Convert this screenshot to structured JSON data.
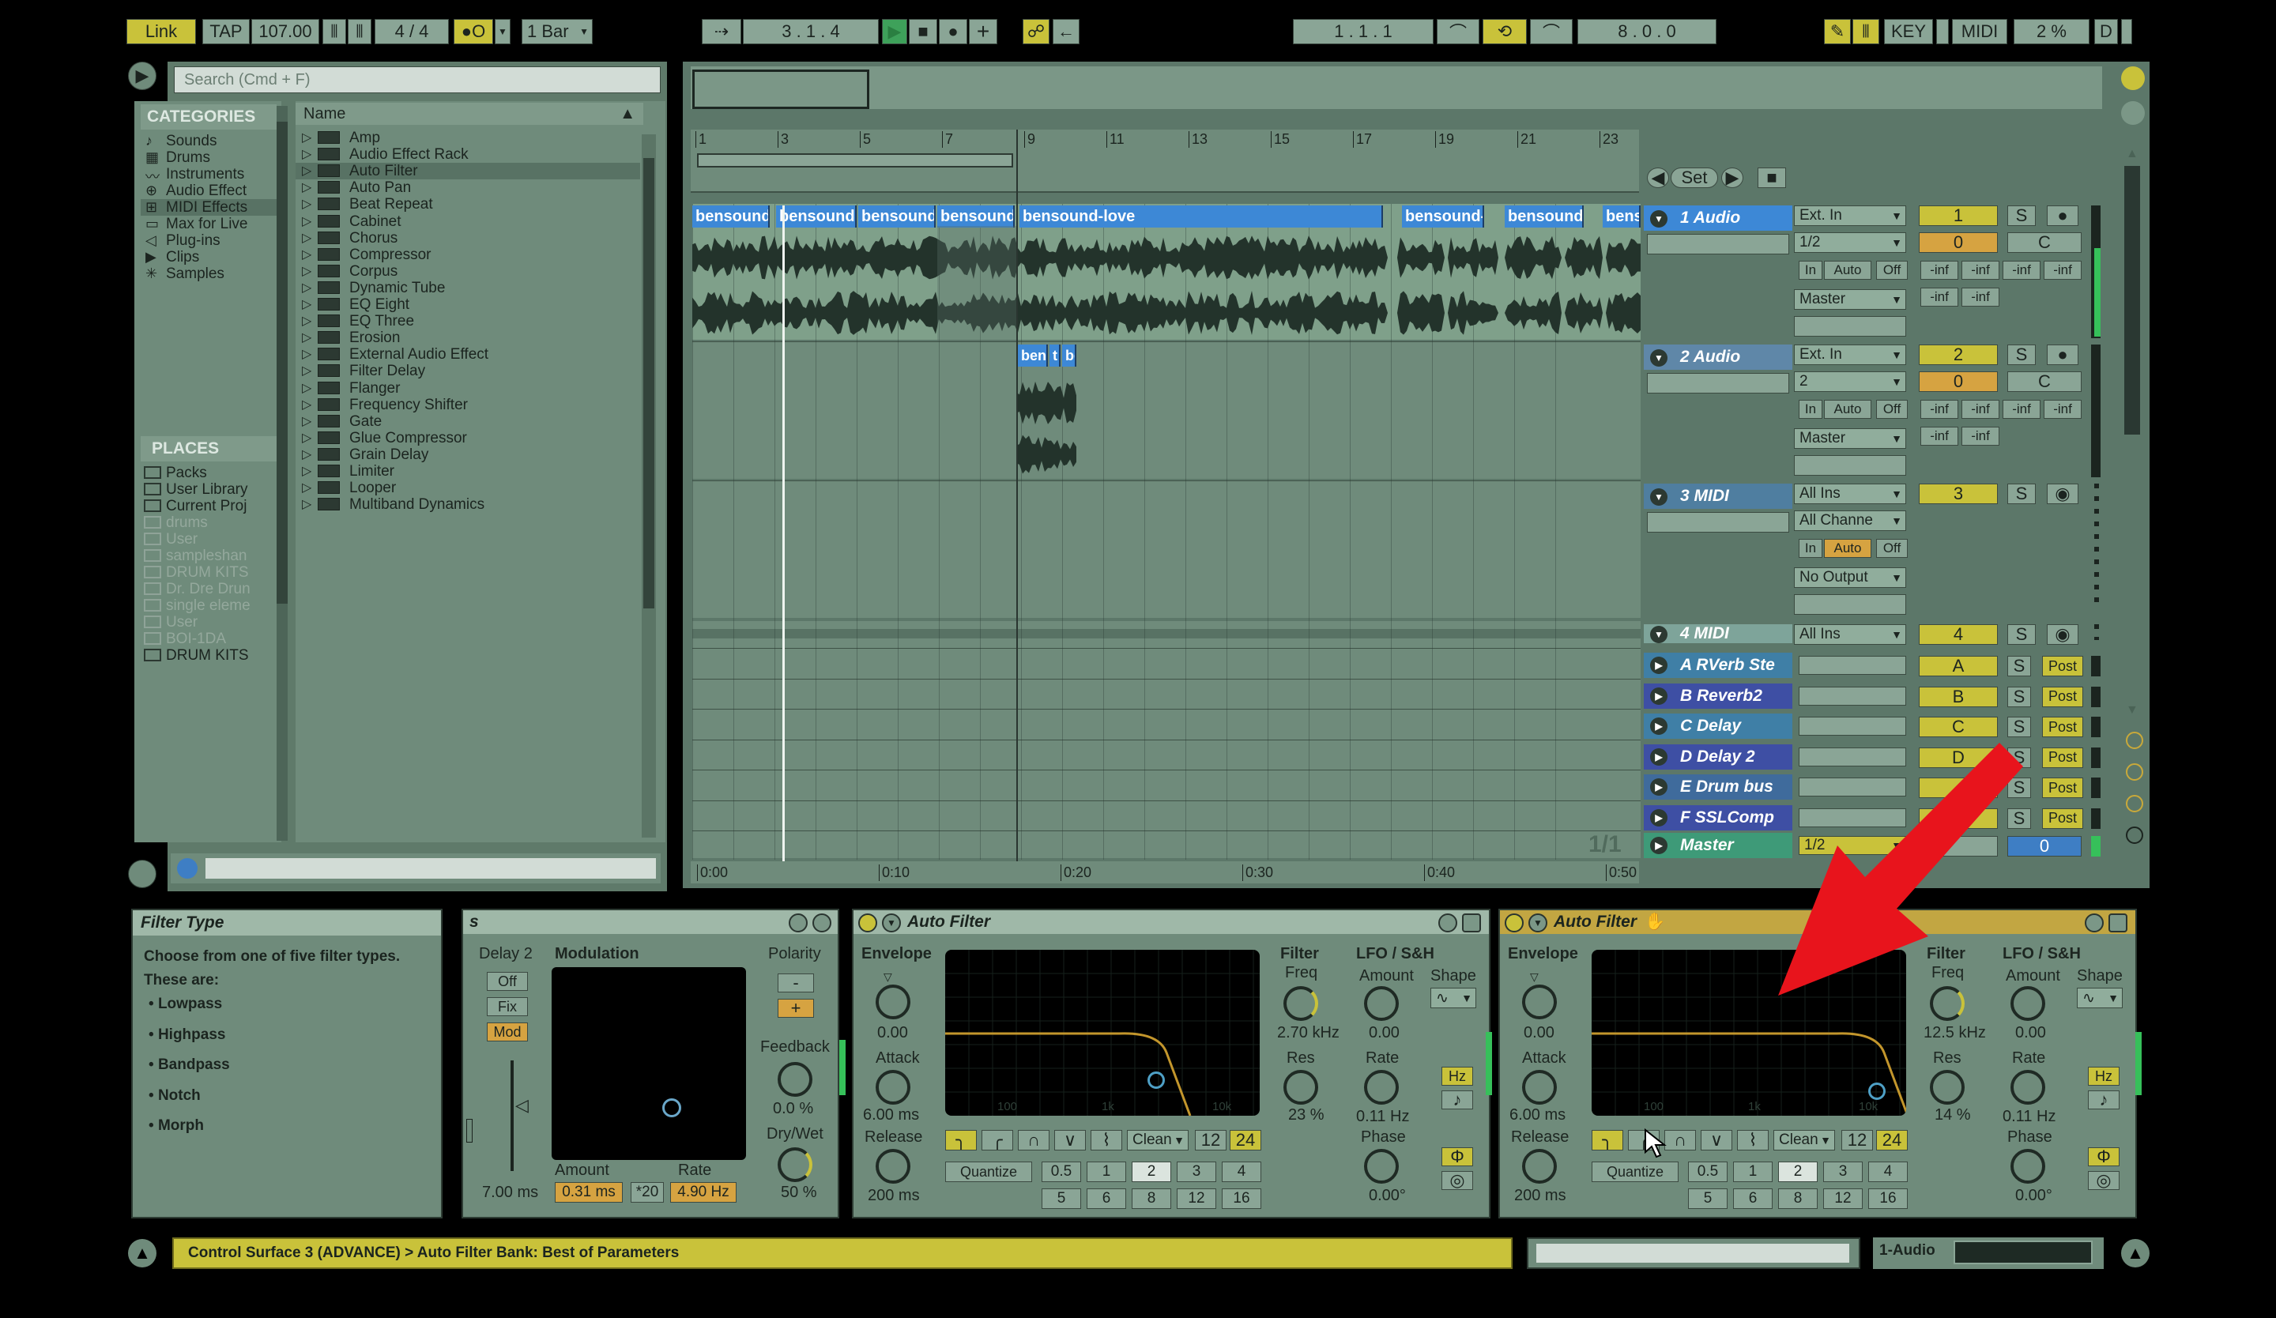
{
  "transport": {
    "link": "Link",
    "tap": "TAP",
    "tempo": "107.00",
    "sig_num": "4",
    "sig_den": "4",
    "quantize": "1 Bar",
    "position": "3 .  1 .  4",
    "loop_start": "1 .  1 .  1",
    "loop_len": "8 .  0 .  0",
    "key": "KEY",
    "midi": "MIDI",
    "cpu": "2 %",
    "d": "D",
    "metronome": "●O"
  },
  "browser": {
    "search_placeholder": "Search (Cmd + F)",
    "categories_title": "CATEGORIES",
    "categories": [
      "Sounds",
      "Drums",
      "Instruments",
      "Audio Effect",
      "MIDI Effects",
      "Max for Live",
      "Plug-ins",
      "Clips",
      "Samples"
    ],
    "places_title": "PLACES",
    "places": [
      "Packs",
      "User Library",
      "Current Proj",
      "drums",
      "User",
      "sampleshan",
      "DRUM KITS",
      "Dr. Dre Drun",
      "single eleme",
      "User",
      "BOI-1DA",
      "DRUM KITS"
    ],
    "name_header": "Name",
    "items": [
      "Amp",
      "Audio Effect Rack",
      "Auto Filter",
      "Auto Pan",
      "Beat Repeat",
      "Cabinet",
      "Chorus",
      "Compressor",
      "Corpus",
      "Dynamic Tube",
      "EQ Eight",
      "EQ Three",
      "Erosion",
      "External Audio Effect",
      "Filter Delay",
      "Flanger",
      "Frequency Shifter",
      "Gate",
      "Glue Compressor",
      "Grain Delay",
      "Limiter",
      "Looper",
      "Multiband Dynamics"
    ]
  },
  "arrangement": {
    "ruler": [
      "1",
      "3",
      "5",
      "7",
      "9",
      "11",
      "13",
      "15",
      "17",
      "19",
      "21",
      "23"
    ],
    "time_ruler": [
      "0:00",
      "0:10",
      "0:20",
      "0:30",
      "0:40",
      "0:50"
    ],
    "set_label": "Set",
    "page": "1/1",
    "clips_track1": [
      "bensound-",
      "bensound-",
      "bensound-",
      "bensound-",
      "bensound-love",
      "bensound-",
      "bensound-",
      "bens"
    ],
    "clips_track2": [
      "ben",
      "t",
      "be"
    ]
  },
  "tracks": [
    {
      "name": "1 Audio",
      "input": "Ext. In",
      "channel": "1/2",
      "out": "Master",
      "num": "1",
      "vol": "0",
      "pan": "C"
    },
    {
      "name": "2 Audio",
      "input": "Ext. In",
      "channel": "2",
      "out": "Master",
      "num": "2",
      "vol": "0",
      "pan": "C"
    },
    {
      "name": "3 MIDI",
      "input": "All Ins",
      "channel": "All Channe",
      "out": "No Output",
      "num": "3"
    },
    {
      "name": "4 MIDI",
      "input": "All Ins",
      "num": "4"
    }
  ],
  "returns": [
    {
      "name": "A RVerb Ste",
      "letter": "A"
    },
    {
      "name": "B Reverb2",
      "letter": "B"
    },
    {
      "name": "C Delay",
      "letter": "C"
    },
    {
      "name": "D Delay 2",
      "letter": "D"
    },
    {
      "name": "E Drum bus",
      "letter": ""
    },
    {
      "name": "F SSLComp",
      "letter": ""
    }
  ],
  "master": {
    "name": "Master",
    "channel": "1/2",
    "vol": "0"
  },
  "mixer_labels": {
    "in": "In",
    "auto": "Auto",
    "off": "Off",
    "inf": "-inf",
    "s": "S",
    "post": "Post"
  },
  "info": {
    "title": "Filter Type",
    "body": "Choose from one of five filter types. These are:",
    "bullets": [
      "Lowpass",
      "Highpass",
      "Bandpass",
      "Notch",
      "Morph"
    ]
  },
  "delay_device": {
    "title": "s",
    "delay_label": "Delay 2",
    "off": "Off",
    "fix": "Fix",
    "mod": "Mod",
    "time": "7.00 ms",
    "modulation": "Modulation",
    "amount": "Amount",
    "rate": "Rate",
    "amount_val": "0.31 ms",
    "rate_mult": "*20",
    "rate_val": "4.90 Hz",
    "polarity": "Polarity",
    "minus": "-",
    "plus": "+",
    "feedback": "Feedback",
    "feedback_val": "0.0 %",
    "drywet": "Dry/Wet",
    "drywet_val": "50 %"
  },
  "filter1": {
    "title": "Auto Filter",
    "envelope": "Envelope",
    "env_amt": "0.00",
    "attack": "Attack",
    "attack_val": "6.00 ms",
    "release": "Release",
    "release_val": "200 ms",
    "filter": "Filter",
    "freq": "Freq",
    "freq_val": "2.70 kHz",
    "res": "Res",
    "res_val": "23 %",
    "lfo": "LFO / S&H",
    "lfo_amt": "Amount",
    "lfo_amt_val": "0.00",
    "shape": "Shape",
    "rate": "Rate",
    "rate_val": "0.11 Hz",
    "phase": "Phase",
    "phase_val": "0.00°",
    "clean": "Clean",
    "p12": "12",
    "p24": "24",
    "quantize": "Quantize",
    "hz": "Hz",
    "grid": [
      "0.5",
      "1",
      "2",
      "3",
      "4",
      "5",
      "6",
      "8",
      "12",
      "16"
    ],
    "freq_axis": [
      "100",
      "1k",
      "10k"
    ]
  },
  "filter2": {
    "title": "Auto Filter",
    "envelope": "Envelope",
    "env_amt": "0.00",
    "attack": "Attack",
    "attack_val": "6.00 ms",
    "release": "Release",
    "release_val": "200 ms",
    "filter": "Filter",
    "freq": "Freq",
    "freq_val": "12.5 kHz",
    "res": "Res",
    "res_val": "14 %",
    "lfo": "LFO / S&H",
    "lfo_amt": "Amount",
    "lfo_amt_val": "0.00",
    "shape": "Shape",
    "rate": "Rate",
    "rate_val": "0.11 Hz",
    "phase": "Phase",
    "phase_val": "0.00°",
    "clean": "Clean",
    "p12": "12",
    "p24": "24",
    "quantize": "Quantize",
    "hz": "Hz",
    "grid": [
      "0.5",
      "1",
      "2",
      "3",
      "4",
      "5",
      "6",
      "8",
      "12",
      "16"
    ],
    "freq_axis": [
      "100",
      "1k",
      "10k"
    ]
  },
  "status": {
    "message": "Control Surface 3 (ADVANCE) > Auto Filter Bank: Best of Parameters",
    "track": "1-Audio"
  },
  "colors": {
    "panel": "#6f8b7b",
    "clip": "#3d88d6",
    "accent": "#c9c23a",
    "arrow": "#e8141c"
  }
}
